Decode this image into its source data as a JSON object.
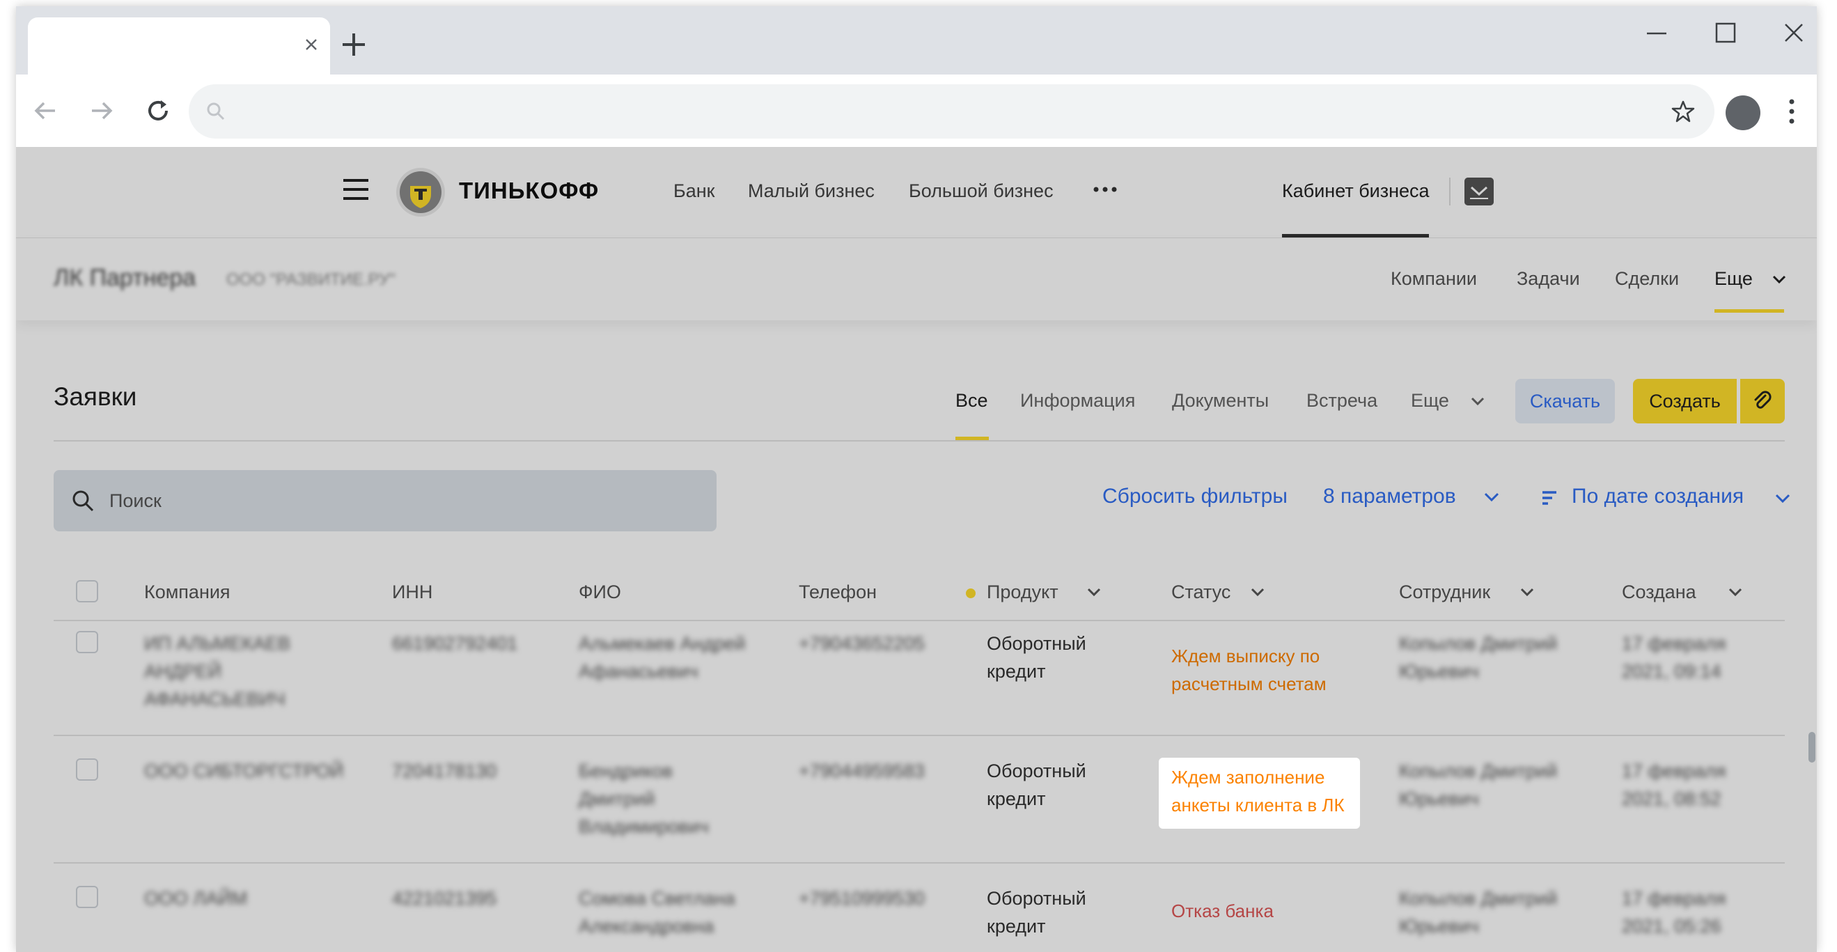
{
  "browser": {
    "omnibox_value": ""
  },
  "topnav": {
    "logo": "ТИНЬКОФФ",
    "links": [
      "Банк",
      "Малый бизнес",
      "Большой бизнес"
    ],
    "cabinet": "Кабинет бизнеса"
  },
  "subnav": {
    "title": "ЛК Партнера",
    "org": "ООО \"РАЗВИТИЕ.РУ\"",
    "links": [
      "Компании",
      "Задачи",
      "Сделки"
    ],
    "more": "Еще"
  },
  "section": {
    "title": "Заявки",
    "tabs": [
      "Все",
      "Информация",
      "Документы",
      "Встреча",
      "Еще"
    ],
    "active_tab": "Все",
    "download": "Скачать",
    "create": "Создать"
  },
  "search": {
    "placeholder": "Поиск"
  },
  "filters": {
    "reset": "Сбросить фильтры",
    "params": "8 параметров",
    "sort": "По дате создания"
  },
  "table": {
    "headers": [
      "Компания",
      "ИНН",
      "ФИО",
      "Телефон",
      "Продукт",
      "Статус",
      "Сотрудник",
      "Создана"
    ],
    "rows": [
      {
        "company": "ИП АЛЬМЕКАЕВ АНДРЕЙ АФАНАСЬЕВИЧ",
        "inn": "661902792401",
        "fio": "Альмекаев Андрей Афанасьевич",
        "phone": "+79043652205",
        "product": "Оборотный кредит",
        "status": "Ждем выписку по расчетным счетам",
        "employee": "Копылов Дмитрий Юрьевич",
        "created": "17 февраля 2021, 09:14"
      },
      {
        "company": "ООО СИБТОРГСТРОЙ",
        "inn": "7204178130",
        "fio": "Бендриков Дмитрий Владимирович",
        "phone": "+79044959583",
        "product": "Оборотный кредит",
        "status": "Ждем заполнение анкеты клиента в ЛК",
        "employee": "Копылов Дмитрий Юрьевич",
        "created": "17 февраля 2021, 08:52"
      },
      {
        "company": "ООО ЛАЙМ",
        "inn": "4221021395",
        "fio": "Сомова Светлана Александровна",
        "phone": "+79510999530",
        "product": "Оборотный кредит",
        "status": "Отказ банка",
        "employee": "Копылов Дмитрий Юрьевич",
        "created": "17 февраля 2021, 05:26"
      }
    ]
  },
  "colors": {
    "accent_yellow": "#ffdd2d",
    "link_blue": "#336fee",
    "status_wait": "#fb8200",
    "status_reject": "#dd5656"
  },
  "icons": [
    "close-icon",
    "plus-icon",
    "minimize-icon",
    "maximize-icon",
    "back-arrow-icon",
    "forward-arrow-icon",
    "reload-icon",
    "search-icon",
    "star-icon",
    "more-vert-icon",
    "menu-icon",
    "tinkoff-logo-icon",
    "more-horiz-icon",
    "mailbox-icon",
    "chevron-down-icon",
    "paperclip-icon",
    "sort-icon"
  ]
}
